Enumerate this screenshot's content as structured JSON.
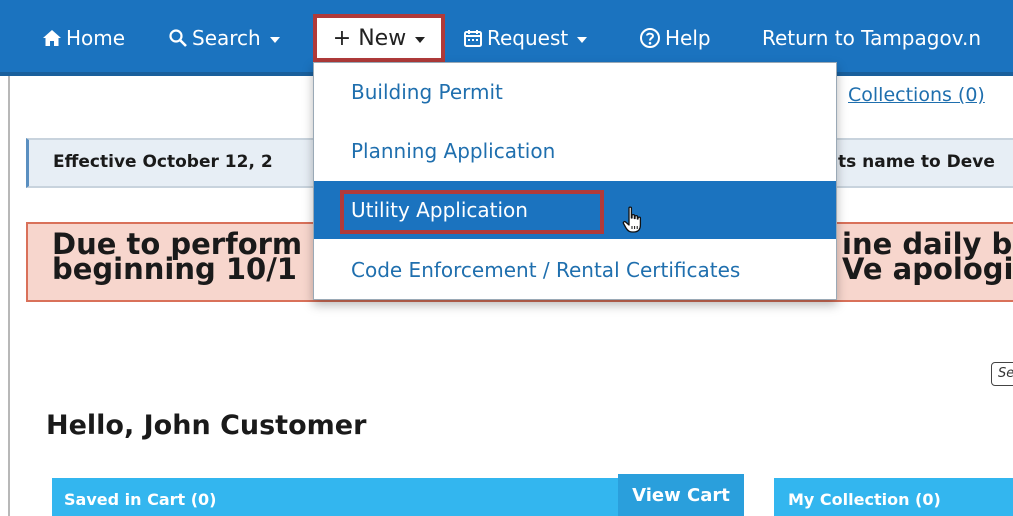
{
  "nav": {
    "home": "Home",
    "search": "Search",
    "new": "+ New",
    "request": "Request",
    "help": "Help",
    "return": "Return to Tampagov.n"
  },
  "new_menu": {
    "items": [
      {
        "label": "Building Permit"
      },
      {
        "label": "Planning Application"
      },
      {
        "label": "Utility Application"
      },
      {
        "label": "Code Enforcement / Rental Certificates"
      }
    ]
  },
  "collections_link": "Collections (0)",
  "notice": {
    "left": "Effective October 12, 2",
    "right": "ts name to Deve"
  },
  "alert": {
    "left_line1": "Due to perform",
    "left_line2": "beginning 10/1",
    "right_line1": "ine daily b",
    "right_line2": "Ve apologi"
  },
  "search_small": "Se",
  "greeting": "Hello, John Customer",
  "cart": {
    "title": "Saved in Cart (0)",
    "button": "View Cart"
  },
  "my_collection": {
    "title": "My Collection (0)"
  },
  "colors": {
    "nav_bg": "#1b73bf",
    "highlight_border": "#b03a3a",
    "link": "#1f6fae",
    "alert_bg": "#f7d6cd",
    "panel_bg": "#33b6ef"
  }
}
